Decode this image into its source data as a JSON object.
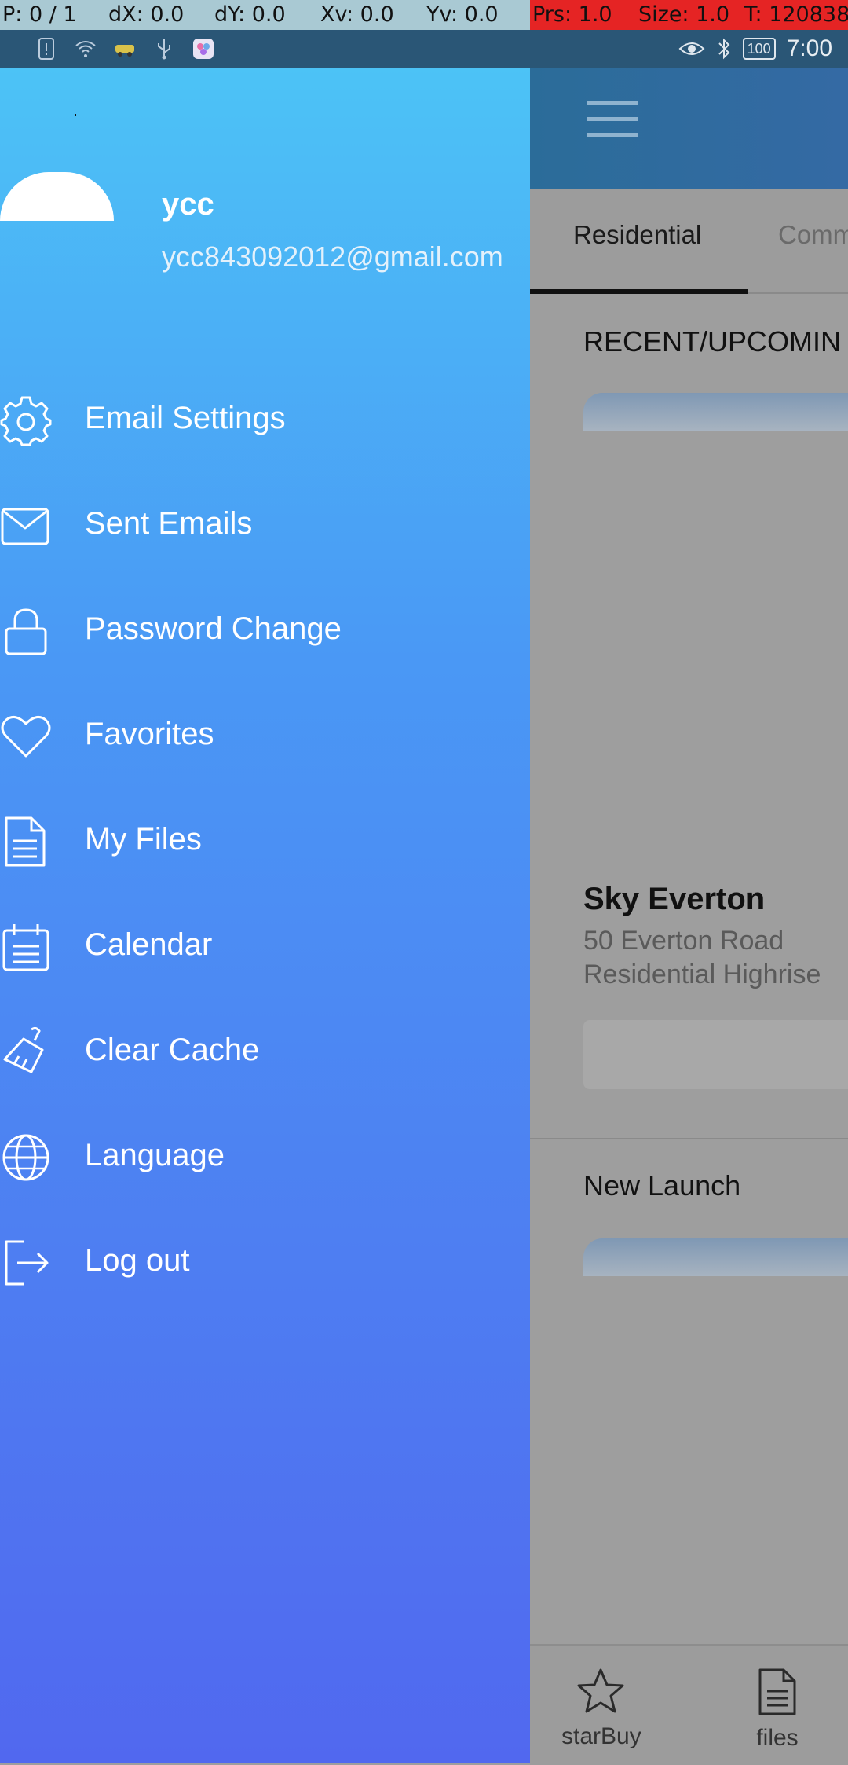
{
  "debug_bar": {
    "pointer": "P: 0 / 1",
    "dx": "dX: 0.0",
    "dy": "dY: 0.0",
    "xv": "Xv: 0.0",
    "yv": "Yv: 0.0",
    "prs": "Prs: 1.0",
    "size": "Size: 1.0",
    "t": "T: 120838"
  },
  "status_bar": {
    "time": "7:00",
    "battery": "100"
  },
  "drawer": {
    "user_name": "ycc",
    "user_email": "ycc843092012@gmail.com",
    "items": [
      {
        "label": "Email Settings",
        "icon": "gear-icon"
      },
      {
        "label": "Sent Emails",
        "icon": "envelope-icon"
      },
      {
        "label": "Password Change",
        "icon": "lock-icon"
      },
      {
        "label": "Favorites",
        "icon": "heart-icon"
      },
      {
        "label": "My Files",
        "icon": "file-icon"
      },
      {
        "label": "Calendar",
        "icon": "calendar-icon"
      },
      {
        "label": "Clear Cache",
        "icon": "broom-icon"
      },
      {
        "label": "Language",
        "icon": "globe-icon"
      },
      {
        "label": "Log out",
        "icon": "logout-icon"
      }
    ]
  },
  "app": {
    "tabs": [
      {
        "label": "Residential",
        "active": true
      },
      {
        "label": "Comm",
        "active": false
      }
    ],
    "section_recent": "RECENT/UPCOMIN",
    "property": {
      "name": "Sky Everton",
      "address": "50 Everton Road",
      "type": "Residential Highrise"
    },
    "section_new_launch": "New Launch",
    "bottom_nav": [
      {
        "label": "starBuy",
        "icon": "star-icon"
      },
      {
        "label": "files",
        "icon": "document-icon"
      }
    ]
  },
  "colors": {
    "drawer_top": "#4cc3f6",
    "drawer_bottom": "#5168ef",
    "scrim": "#9e9e9e",
    "debug_red": "#e52424"
  }
}
